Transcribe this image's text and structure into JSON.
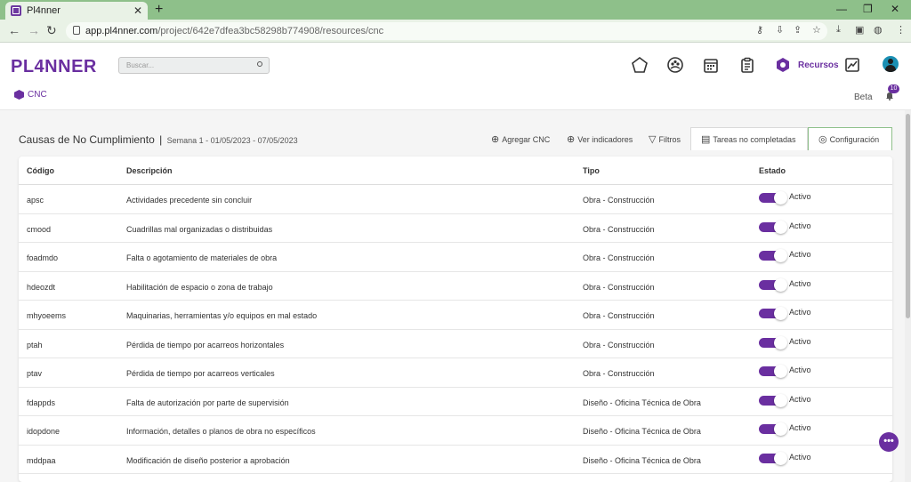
{
  "browser": {
    "tab_title": "Pl4nner",
    "tab_close": "✕",
    "new_tab": "+",
    "url_host": "app.pl4nner.com",
    "url_path": "/project/642e7dfea3bc58298b774908/resources/cnc"
  },
  "app": {
    "logo": "PL4NNER",
    "search_placeholder": "Buscar...",
    "recursos_label": "Recursos",
    "crumb_label": "CNC",
    "beta_label": "Beta",
    "notifications_count": "10",
    "accent_color": "#6a2fa0"
  },
  "page": {
    "title": "Causas de No Cumplimiento",
    "separator": "|",
    "subtitle": "Semana 1 - 01/05/2023 - 07/05/2023",
    "toolbar": {
      "add": "Agregar CNC",
      "indicators": "Ver indicadores",
      "filters": "Filtros",
      "incomplete": "Tareas no completadas",
      "config": "Configuración"
    }
  },
  "table": {
    "headers": {
      "code": "Código",
      "description": "Descripción",
      "type": "Tipo",
      "status": "Estado"
    },
    "rows": [
      {
        "code": "apsc",
        "description": "Actividades precedente sin concluir",
        "type": "Obra - Construcción",
        "status": "Activo"
      },
      {
        "code": "cmood",
        "description": "Cuadrillas mal organizadas o distribuidas",
        "type": "Obra - Construcción",
        "status": "Activo"
      },
      {
        "code": "foadmdo",
        "description": "Falta o agotamiento de materiales de obra",
        "type": "Obra - Construcción",
        "status": "Activo"
      },
      {
        "code": "hdeozdt",
        "description": "Habilitación de espacio o zona de trabajo",
        "type": "Obra - Construcción",
        "status": "Activo"
      },
      {
        "code": "mhyoeems",
        "description": "Maquinarias, herramientas y/o equipos en mal estado",
        "type": "Obra - Construcción",
        "status": "Activo"
      },
      {
        "code": "ptah",
        "description": "Pérdida de tiempo por acarreos horizontales",
        "type": "Obra - Construcción",
        "status": "Activo"
      },
      {
        "code": "ptav",
        "description": "Pérdida de tiempo por acarreos verticales",
        "type": "Obra - Construcción",
        "status": "Activo"
      },
      {
        "code": "fdappds",
        "description": "Falta de autorización por parte de supervisión",
        "type": "Diseño - Oficina Técnica de Obra",
        "status": "Activo"
      },
      {
        "code": "idopdone",
        "description": "Información, detalles o planos de obra no específicos",
        "type": "Diseño - Oficina Técnica de Obra",
        "status": "Activo"
      },
      {
        "code": "mddpaa",
        "description": "Modificación de diseño posterior a aprobación",
        "type": "Diseño - Oficina Técnica de Obra",
        "status": "Activo"
      }
    ]
  },
  "fab": {
    "label": "•••"
  }
}
